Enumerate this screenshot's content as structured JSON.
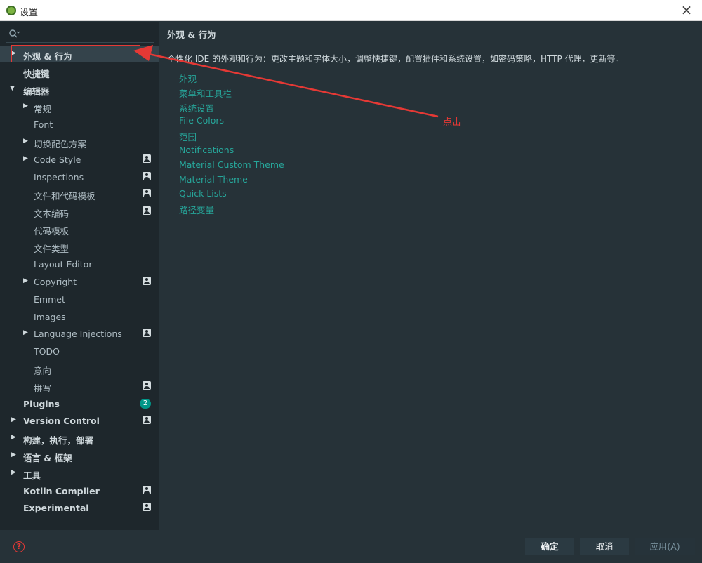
{
  "window": {
    "title": "设置"
  },
  "search": {
    "placeholder": ""
  },
  "sidebar": {
    "items": [
      {
        "label": "外观 & 行为",
        "arrow": "▶"
      },
      {
        "label": "快捷键",
        "arrow": ""
      },
      {
        "label": "编辑器",
        "arrow": "▼"
      },
      {
        "label": "常规",
        "arrow": "▶"
      },
      {
        "label": "Font",
        "arrow": ""
      },
      {
        "label": "切换配色方案",
        "arrow": "▶"
      },
      {
        "label": "Code Style",
        "arrow": "▶"
      },
      {
        "label": "Inspections",
        "arrow": ""
      },
      {
        "label": "文件和代码模板",
        "arrow": ""
      },
      {
        "label": "文本编码",
        "arrow": ""
      },
      {
        "label": "代码模板",
        "arrow": ""
      },
      {
        "label": "文件类型",
        "arrow": ""
      },
      {
        "label": "Layout Editor",
        "arrow": ""
      },
      {
        "label": "Copyright",
        "arrow": "▶"
      },
      {
        "label": "Emmet",
        "arrow": ""
      },
      {
        "label": "Images",
        "arrow": ""
      },
      {
        "label": "Language Injections",
        "arrow": "▶"
      },
      {
        "label": "TODO",
        "arrow": ""
      },
      {
        "label": "意向",
        "arrow": ""
      },
      {
        "label": "拼写",
        "arrow": ""
      },
      {
        "label": "Plugins",
        "arrow": "",
        "badge": "2"
      },
      {
        "label": "Version Control",
        "arrow": "▶"
      },
      {
        "label": "构建，执行，部署",
        "arrow": "▶"
      },
      {
        "label": "语言 & 框架",
        "arrow": "▶"
      },
      {
        "label": "工具",
        "arrow": "▶"
      },
      {
        "label": "Kotlin Compiler",
        "arrow": ""
      },
      {
        "label": "Experimental",
        "arrow": ""
      }
    ]
  },
  "main": {
    "title": "外观 & 行为",
    "description": "个性化 IDE 的外观和行为：更改主题和字体大小，调整快捷键，配置插件和系统设置，如密码策略，HTTP 代理，更新等。",
    "links": [
      "外观",
      "菜单和工具栏",
      "系统设置",
      "File Colors",
      "范围",
      "Notifications",
      "Material Custom Theme",
      "Material Theme",
      "Quick Lists",
      "路径变量"
    ]
  },
  "annotation": {
    "text": "点击"
  },
  "footer": {
    "ok": "确定",
    "cancel": "取消",
    "apply": "应用(A)",
    "help": "?"
  },
  "colors": {
    "accent_link": "#26a69a",
    "annotation": "#e53935",
    "badge": "#009688"
  }
}
